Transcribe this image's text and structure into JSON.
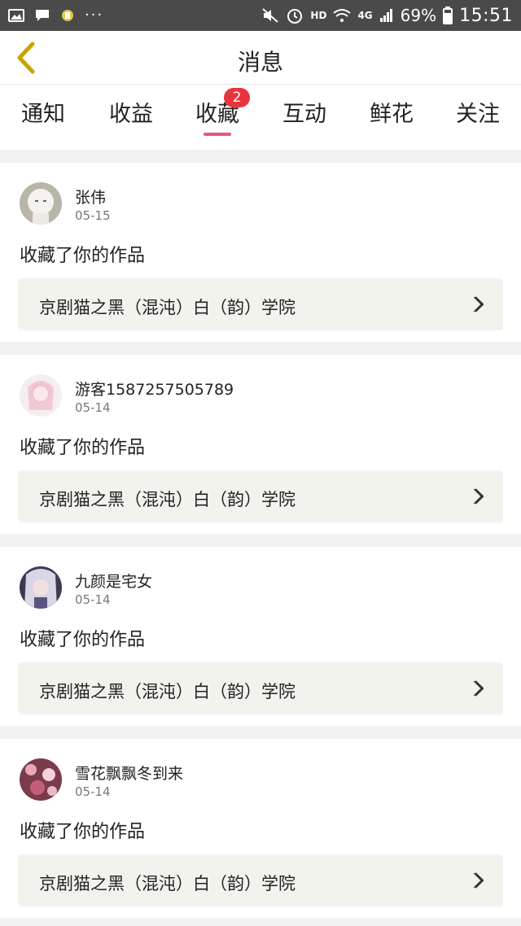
{
  "status_bar": {
    "left_icons": [
      "image-icon",
      "chat-icon",
      "app-badge-icon",
      "more-dots-icon"
    ],
    "dots": "···",
    "hd": "HD",
    "net": "4G",
    "battery": "69%",
    "time": "15:51"
  },
  "header": {
    "title": "消息",
    "back_icon": "chevron-left-icon"
  },
  "tabs": [
    {
      "label": "通知"
    },
    {
      "label": "收益"
    },
    {
      "label": "收藏",
      "badge": "2",
      "active": true
    },
    {
      "label": "互动"
    },
    {
      "label": "鲜花"
    },
    {
      "label": "关注"
    }
  ],
  "colors": {
    "accent": "#e8548b",
    "badge": "#e8343e",
    "status_bar": "#4a4a4a",
    "work_box": "#f3f3ee"
  },
  "notifications": [
    {
      "user": "张伟",
      "date": "05-15",
      "action": "收藏了你的作品",
      "work": "京剧猫之黑（混沌）白（韵）学院",
      "chevron_icon": "chevron-right-icon"
    },
    {
      "user": "游客1587257505789",
      "date": "05-14",
      "action": "收藏了你的作品",
      "work": "京剧猫之黑（混沌）白（韵）学院",
      "chevron_icon": "chevron-right-icon"
    },
    {
      "user": "九颜是宅女",
      "date": "05-14",
      "action": "收藏了你的作品",
      "work": "京剧猫之黑（混沌）白（韵）学院",
      "chevron_icon": "chevron-right-icon"
    },
    {
      "user": "雪花飘飘冬到来",
      "date": "05-14",
      "action": "收藏了你的作品",
      "work": "京剧猫之黑（混沌）白（韵）学院",
      "chevron_icon": "chevron-right-icon"
    }
  ]
}
